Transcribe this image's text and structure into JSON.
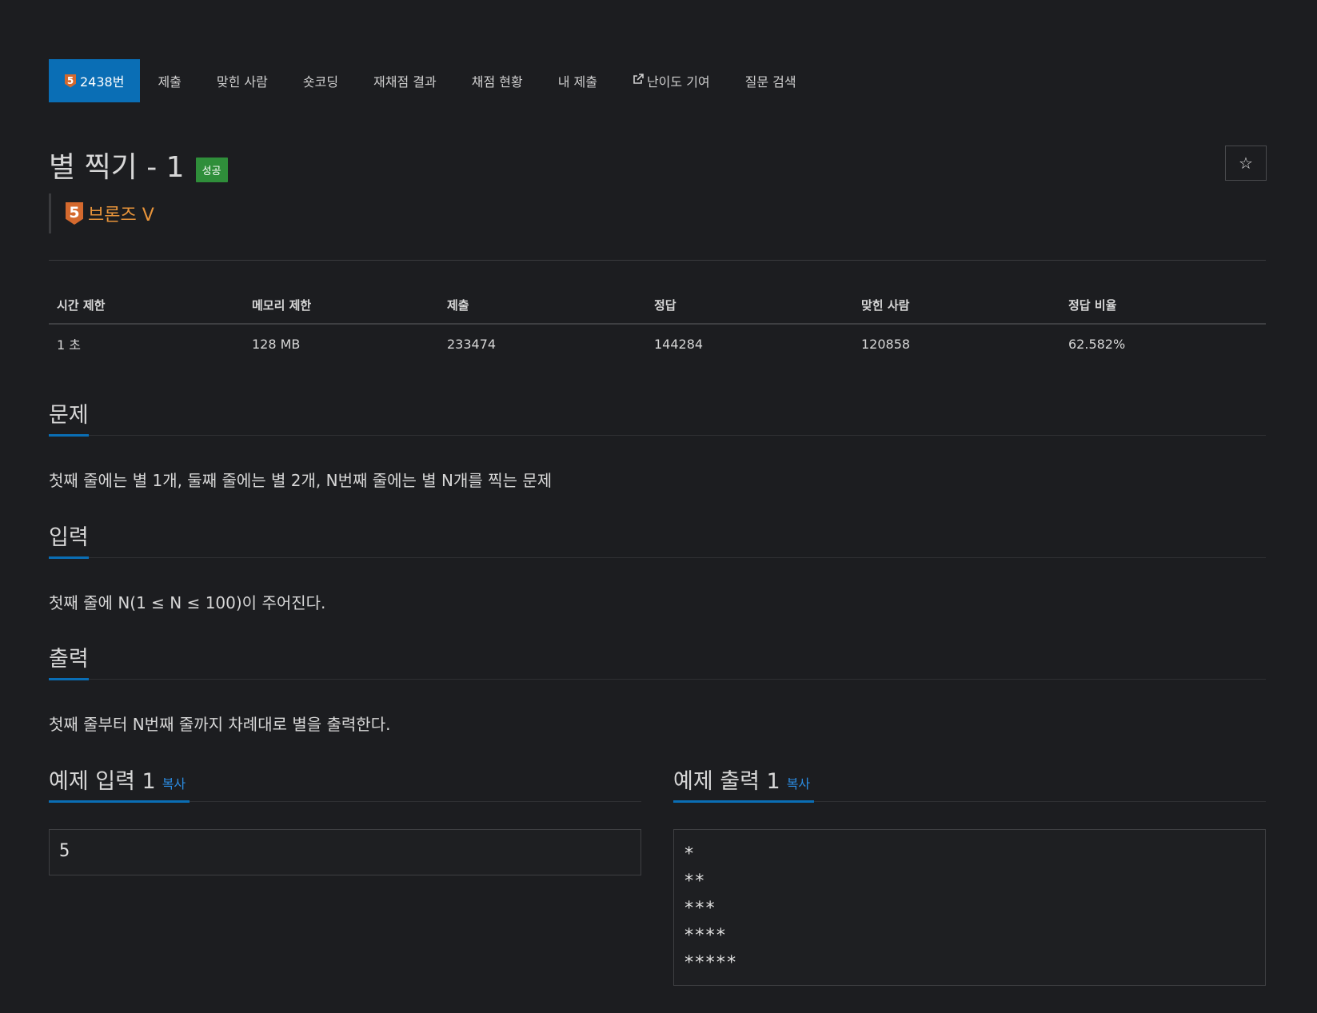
{
  "nav": {
    "problem_number": "2438번",
    "tier_badge_digit": "5",
    "items": [
      "제출",
      "맞힌 사람",
      "숏코딩",
      "재채점 결과",
      "채점 현황",
      "내 제출",
      "난이도 기여",
      "질문 검색"
    ]
  },
  "problem": {
    "title": "별 찍기 - 1",
    "status_badge": "성공",
    "tier_digit": "5",
    "tier_name": "브론즈 V",
    "star_icon": "☆"
  },
  "stats": {
    "headers": [
      "시간 제한",
      "메모리 제한",
      "제출",
      "정답",
      "맞힌 사람",
      "정답 비율"
    ],
    "values": [
      "1 초",
      "128 MB",
      "233474",
      "144284",
      "120858",
      "62.582%"
    ]
  },
  "sections": {
    "description": {
      "title": "문제",
      "text": "첫째 줄에는 별 1개, 둘째 줄에는 별 2개, N번째 줄에는 별 N개를 찍는 문제"
    },
    "input": {
      "title": "입력",
      "text": "첫째 줄에 N(1 ≤ N ≤ 100)이 주어진다."
    },
    "output": {
      "title": "출력",
      "text": "첫째 줄부터 N번째 줄까지 차례대로 별을 출력한다."
    }
  },
  "samples": {
    "input_title": "예제 입력 1",
    "output_title": "예제 출력 1",
    "copy_label": "복사",
    "input_value": "5",
    "output_value": "*\n**\n***\n****\n*****"
  },
  "colors": {
    "accent": "#0a6eb5",
    "success": "#2f8e3a",
    "bronze": "#d4692e",
    "tier_text": "#e8943a",
    "background": "#1c1d20"
  }
}
